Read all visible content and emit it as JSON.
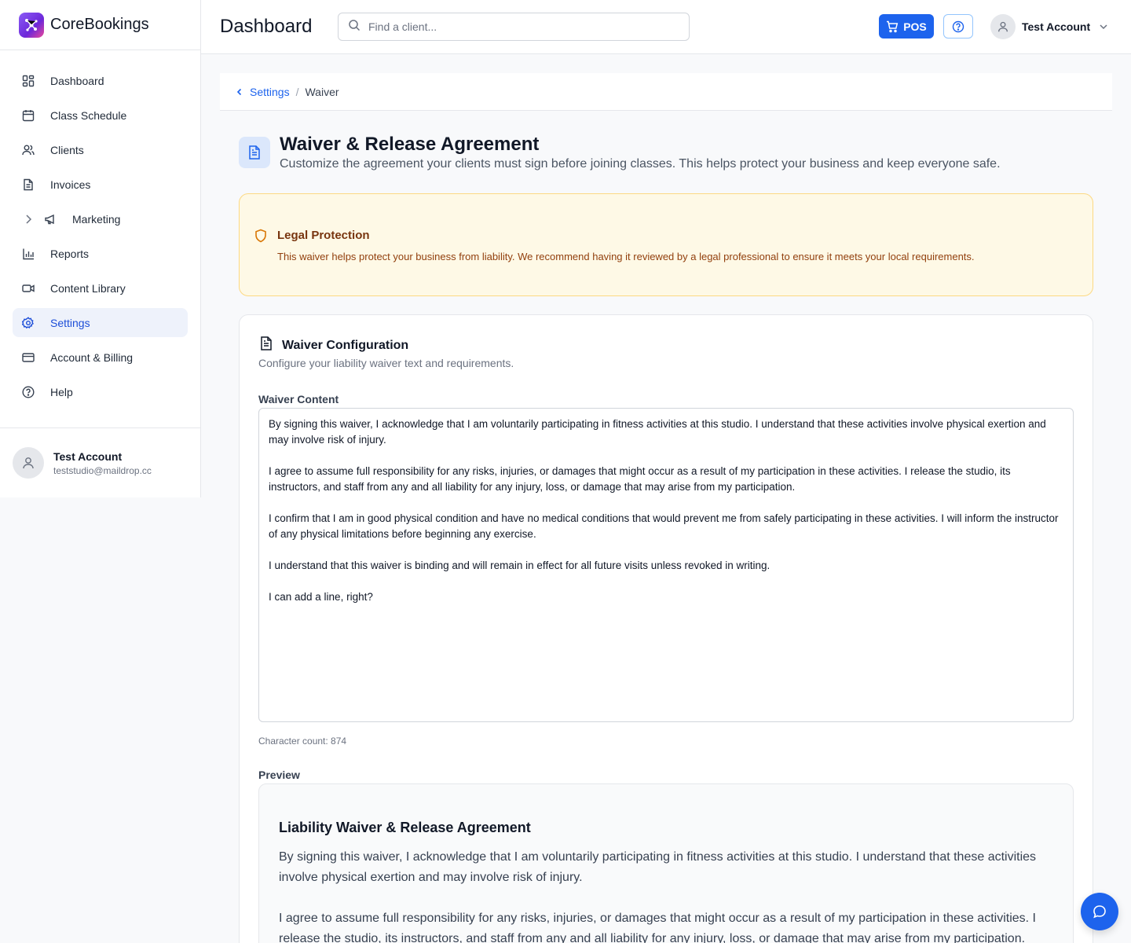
{
  "brand": {
    "name": "CoreBookings"
  },
  "sidebar": {
    "items": [
      {
        "label": "Dashboard",
        "icon": "grid-icon"
      },
      {
        "label": "Class Schedule",
        "icon": "calendar-icon"
      },
      {
        "label": "Clients",
        "icon": "users-icon"
      },
      {
        "label": "Invoices",
        "icon": "file-icon"
      },
      {
        "label": "Marketing",
        "icon": "megaphone-icon"
      },
      {
        "label": "Reports",
        "icon": "bar-chart-icon"
      },
      {
        "label": "Content Library",
        "icon": "video-icon"
      },
      {
        "label": "Settings",
        "icon": "gear-icon",
        "active": true
      },
      {
        "label": "Account & Billing",
        "icon": "credit-card-icon"
      },
      {
        "label": "Help",
        "icon": "help-circle-icon"
      }
    ],
    "user": {
      "name": "Test Account",
      "email": "teststudio@maildrop.cc"
    }
  },
  "header": {
    "title": "Dashboard",
    "search_placeholder": "Find a client...",
    "pos_label": "POS",
    "account_name": "Test Account"
  },
  "breadcrumb": {
    "parent": "Settings",
    "separator": "/",
    "current": "Waiver"
  },
  "page": {
    "title": "Waiver & Release Agreement",
    "subtitle": "Customize the agreement your clients must sign before joining classes. This helps protect your business and keep everyone safe."
  },
  "alert": {
    "title": "Legal Protection",
    "body": "This waiver helps protect your business from liability. We recommend having it reviewed by a legal professional to ensure it meets your local requirements."
  },
  "config": {
    "title": "Waiver Configuration",
    "subtitle": "Configure your liability waiver text and requirements.",
    "content_label": "Waiver Content",
    "content": "By signing this waiver, I acknowledge that I am voluntarily participating in fitness activities at this studio. I understand that these activities involve physical exertion and may involve risk of injury.\n\nI agree to assume full responsibility for any risks, injuries, or damages that might occur as a result of my participation in these activities. I release the studio, its instructors, and staff from any and all liability for any injury, loss, or damage that may arise from my participation.\n\nI confirm that I am in good physical condition and have no medical conditions that would prevent me from safely participating in these activities. I will inform the instructor of any physical limitations before beginning any exercise.\n\nI understand that this waiver is binding and will remain in effect for all future visits unless revoked in writing.\n\nI can add a line, right?",
    "char_count": "Character count: 874",
    "preview_label": "Preview",
    "preview_title": "Liability Waiver & Release Agreement",
    "preview_body": "By signing this waiver, I acknowledge that I am voluntarily participating in fitness activities at this studio. I understand that these activities involve physical exertion and may involve risk of injury.\n\nI agree to assume full responsibility for any risks, injuries, or damages that might occur as a result of my participation in these activities. I release the studio, its instructors, and staff from any and all liability for any injury, loss, or damage that may arise from my participation."
  },
  "colors": {
    "accent": "#1d63ed",
    "active_bg": "#eef2fb",
    "alert_bg": "#fef9e6",
    "alert_border": "#fcd983",
    "alert_text": "#92400e"
  }
}
